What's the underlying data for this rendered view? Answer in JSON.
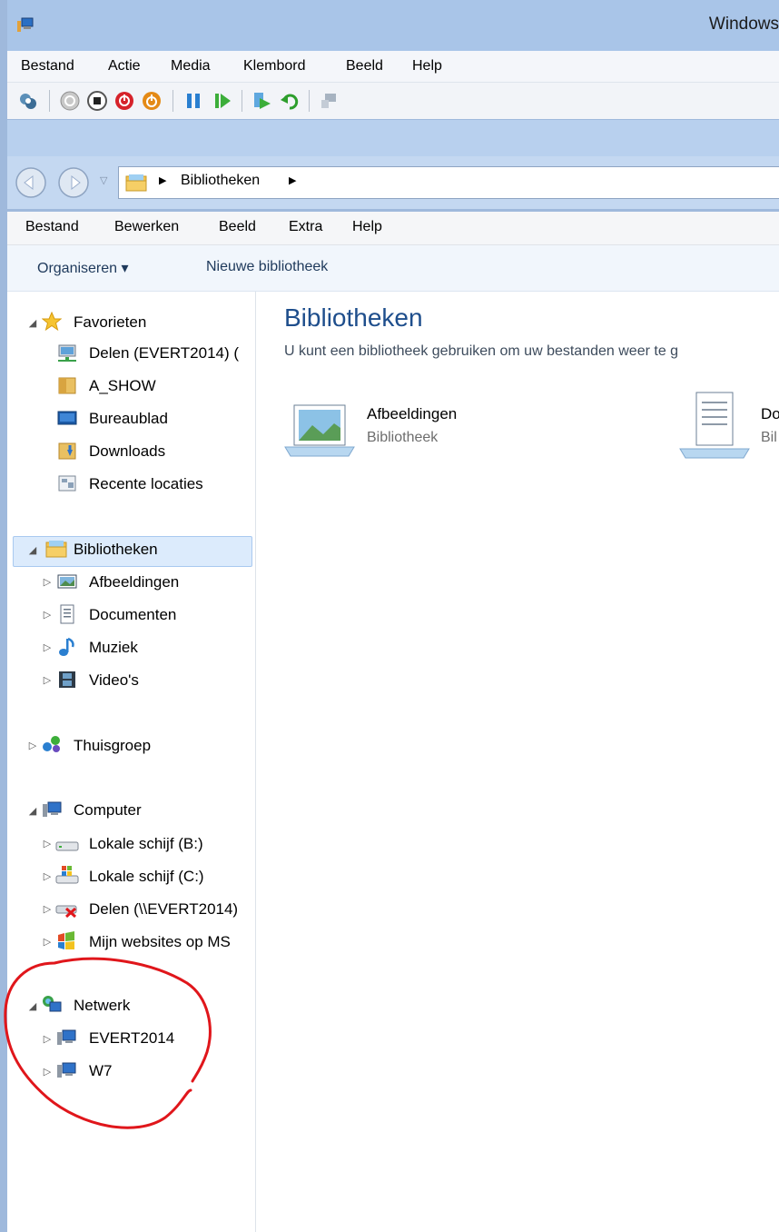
{
  "window": {
    "title": "Windows"
  },
  "vm_menu": [
    "Bestand",
    "Actie",
    "Media",
    "Klembord",
    "Beeld",
    "Help"
  ],
  "address": {
    "crumb": "Bibliotheken"
  },
  "explorer_menu": [
    "Bestand",
    "Bewerken",
    "Beeld",
    "Extra",
    "Help"
  ],
  "commands": {
    "organize": "Organiseren ▾",
    "new_library": "Nieuwe bibliotheek"
  },
  "nav": {
    "favorites": {
      "label": "Favorieten",
      "items": [
        "Delen (EVERT2014) (",
        "A_SHOW",
        "Bureaublad",
        "Downloads",
        "Recente locaties"
      ]
    },
    "libraries": {
      "label": "Bibliotheken",
      "items": [
        "Afbeeldingen",
        "Documenten",
        "Muziek",
        "Video's"
      ]
    },
    "homegroup": {
      "label": "Thuisgroep"
    },
    "computer": {
      "label": "Computer",
      "items": [
        "Lokale schijf (B:)",
        "Lokale schijf (C:)",
        "Delen (\\\\EVERT2014)",
        "Mijn websites op MS"
      ]
    },
    "network": {
      "label": "Netwerk",
      "items": [
        "EVERT2014",
        "W7"
      ]
    }
  },
  "content": {
    "title": "Bibliotheken",
    "subtitle": "U kunt een bibliotheek gebruiken om uw bestanden weer te g",
    "libraries": [
      {
        "name": "Afbeeldingen",
        "type": "Bibliotheek"
      },
      {
        "name": "Do",
        "type": "Bil"
      }
    ]
  },
  "colors": {
    "annotation": "#e0161b",
    "selection": "#dcebfc",
    "title_blue": "#1e4e8c"
  }
}
